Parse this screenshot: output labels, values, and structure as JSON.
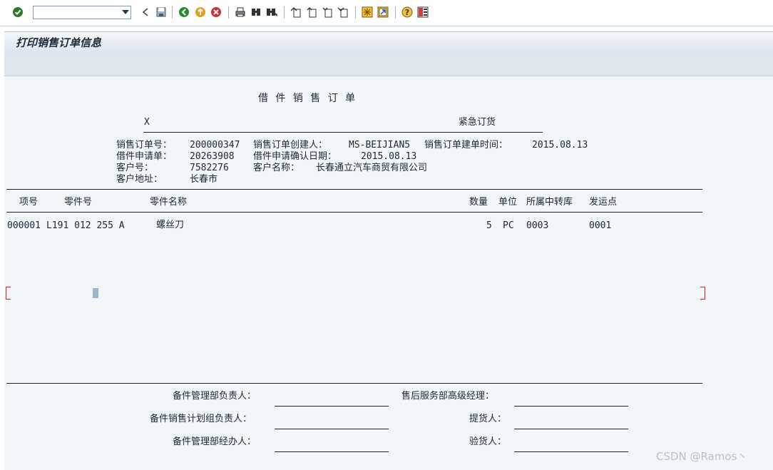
{
  "toolbar": {
    "command_value": "",
    "icons": [
      "enter-icon",
      "back-arrow-icon",
      "save-icon",
      "back-icon",
      "exit-icon",
      "cancel-icon",
      "print-icon",
      "find-icon",
      "find-next-icon",
      "first-page-icon",
      "previous-page-icon",
      "next-page-icon",
      "last-page-icon",
      "create-session-icon",
      "shortcut-icon",
      "help-icon",
      "layout-icon"
    ]
  },
  "title": "打印销售订单信息",
  "document": {
    "heading": "借 件 销 售 订 单",
    "flag_x": "X",
    "urgent": "紧急订货",
    "fields": {
      "so_no_label": "销售订单号：",
      "so_no": "200000347",
      "creator_label": "销售订单创建人：",
      "creator": "MS-BEIJIAN5",
      "create_time_label": "销售订单建单时间：",
      "create_time": "2015.08.13",
      "loan_req_label": "借件申请单：",
      "loan_req": "20263908",
      "loan_confirm_label": "借件申请确认日期：",
      "loan_confirm": "2015.08.13",
      "cust_no_label": "客户号：",
      "cust_no": "7582276",
      "cust_name_label": "客户名称：",
      "cust_name": "长春通立汽车商贸有限公司",
      "cust_addr_label": "客户地址：",
      "cust_addr": "长春市"
    },
    "columns": {
      "item": "项号",
      "part_no": "零件号",
      "part_name": "零件名称",
      "qty": "数量",
      "unit": "单位",
      "warehouse": "所属中转库",
      "ship_point": "发运点"
    },
    "rows": [
      {
        "item": "000001",
        "part_no": "L191 012 255 A",
        "part_name": "螺丝刀",
        "qty": "5",
        "unit": "PC",
        "warehouse": "0003",
        "ship_point": "0001"
      }
    ],
    "signatures": {
      "mgmt_head": "备件管理部负责人：",
      "aftersales_mgr": "售后服务部高级经理：",
      "plan_head": "备件销售计划组负责人：",
      "pickup": "提货人：",
      "mgmt_handler": "备件管理部经办人：",
      "inspector": "验货人："
    }
  },
  "watermark": "CSDN @Ramos丶"
}
